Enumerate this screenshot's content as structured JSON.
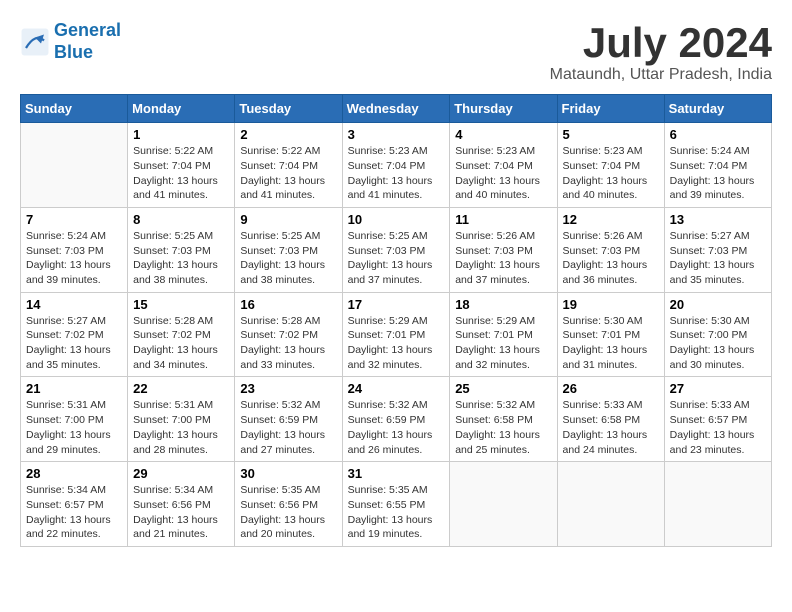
{
  "logo": {
    "line1": "General",
    "line2": "Blue"
  },
  "title": "July 2024",
  "location": "Mataundh, Uttar Pradesh, India",
  "days_of_week": [
    "Sunday",
    "Monday",
    "Tuesday",
    "Wednesday",
    "Thursday",
    "Friday",
    "Saturday"
  ],
  "weeks": [
    [
      {
        "day": "",
        "info": ""
      },
      {
        "day": "1",
        "info": "Sunrise: 5:22 AM\nSunset: 7:04 PM\nDaylight: 13 hours\nand 41 minutes."
      },
      {
        "day": "2",
        "info": "Sunrise: 5:22 AM\nSunset: 7:04 PM\nDaylight: 13 hours\nand 41 minutes."
      },
      {
        "day": "3",
        "info": "Sunrise: 5:23 AM\nSunset: 7:04 PM\nDaylight: 13 hours\nand 41 minutes."
      },
      {
        "day": "4",
        "info": "Sunrise: 5:23 AM\nSunset: 7:04 PM\nDaylight: 13 hours\nand 40 minutes."
      },
      {
        "day": "5",
        "info": "Sunrise: 5:23 AM\nSunset: 7:04 PM\nDaylight: 13 hours\nand 40 minutes."
      },
      {
        "day": "6",
        "info": "Sunrise: 5:24 AM\nSunset: 7:04 PM\nDaylight: 13 hours\nand 39 minutes."
      }
    ],
    [
      {
        "day": "7",
        "info": "Sunrise: 5:24 AM\nSunset: 7:03 PM\nDaylight: 13 hours\nand 39 minutes."
      },
      {
        "day": "8",
        "info": "Sunrise: 5:25 AM\nSunset: 7:03 PM\nDaylight: 13 hours\nand 38 minutes."
      },
      {
        "day": "9",
        "info": "Sunrise: 5:25 AM\nSunset: 7:03 PM\nDaylight: 13 hours\nand 38 minutes."
      },
      {
        "day": "10",
        "info": "Sunrise: 5:25 AM\nSunset: 7:03 PM\nDaylight: 13 hours\nand 37 minutes."
      },
      {
        "day": "11",
        "info": "Sunrise: 5:26 AM\nSunset: 7:03 PM\nDaylight: 13 hours\nand 37 minutes."
      },
      {
        "day": "12",
        "info": "Sunrise: 5:26 AM\nSunset: 7:03 PM\nDaylight: 13 hours\nand 36 minutes."
      },
      {
        "day": "13",
        "info": "Sunrise: 5:27 AM\nSunset: 7:03 PM\nDaylight: 13 hours\nand 35 minutes."
      }
    ],
    [
      {
        "day": "14",
        "info": "Sunrise: 5:27 AM\nSunset: 7:02 PM\nDaylight: 13 hours\nand 35 minutes."
      },
      {
        "day": "15",
        "info": "Sunrise: 5:28 AM\nSunset: 7:02 PM\nDaylight: 13 hours\nand 34 minutes."
      },
      {
        "day": "16",
        "info": "Sunrise: 5:28 AM\nSunset: 7:02 PM\nDaylight: 13 hours\nand 33 minutes."
      },
      {
        "day": "17",
        "info": "Sunrise: 5:29 AM\nSunset: 7:01 PM\nDaylight: 13 hours\nand 32 minutes."
      },
      {
        "day": "18",
        "info": "Sunrise: 5:29 AM\nSunset: 7:01 PM\nDaylight: 13 hours\nand 32 minutes."
      },
      {
        "day": "19",
        "info": "Sunrise: 5:30 AM\nSunset: 7:01 PM\nDaylight: 13 hours\nand 31 minutes."
      },
      {
        "day": "20",
        "info": "Sunrise: 5:30 AM\nSunset: 7:00 PM\nDaylight: 13 hours\nand 30 minutes."
      }
    ],
    [
      {
        "day": "21",
        "info": "Sunrise: 5:31 AM\nSunset: 7:00 PM\nDaylight: 13 hours\nand 29 minutes."
      },
      {
        "day": "22",
        "info": "Sunrise: 5:31 AM\nSunset: 7:00 PM\nDaylight: 13 hours\nand 28 minutes."
      },
      {
        "day": "23",
        "info": "Sunrise: 5:32 AM\nSunset: 6:59 PM\nDaylight: 13 hours\nand 27 minutes."
      },
      {
        "day": "24",
        "info": "Sunrise: 5:32 AM\nSunset: 6:59 PM\nDaylight: 13 hours\nand 26 minutes."
      },
      {
        "day": "25",
        "info": "Sunrise: 5:32 AM\nSunset: 6:58 PM\nDaylight: 13 hours\nand 25 minutes."
      },
      {
        "day": "26",
        "info": "Sunrise: 5:33 AM\nSunset: 6:58 PM\nDaylight: 13 hours\nand 24 minutes."
      },
      {
        "day": "27",
        "info": "Sunrise: 5:33 AM\nSunset: 6:57 PM\nDaylight: 13 hours\nand 23 minutes."
      }
    ],
    [
      {
        "day": "28",
        "info": "Sunrise: 5:34 AM\nSunset: 6:57 PM\nDaylight: 13 hours\nand 22 minutes."
      },
      {
        "day": "29",
        "info": "Sunrise: 5:34 AM\nSunset: 6:56 PM\nDaylight: 13 hours\nand 21 minutes."
      },
      {
        "day": "30",
        "info": "Sunrise: 5:35 AM\nSunset: 6:56 PM\nDaylight: 13 hours\nand 20 minutes."
      },
      {
        "day": "31",
        "info": "Sunrise: 5:35 AM\nSunset: 6:55 PM\nDaylight: 13 hours\nand 19 minutes."
      },
      {
        "day": "",
        "info": ""
      },
      {
        "day": "",
        "info": ""
      },
      {
        "day": "",
        "info": ""
      }
    ]
  ]
}
